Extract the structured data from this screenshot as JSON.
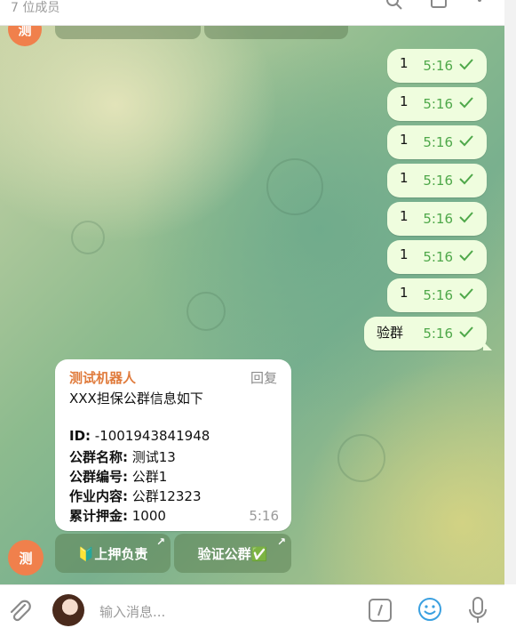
{
  "header": {
    "subtitle": "7 位成员"
  },
  "top_avatar_letter": "测",
  "outgoing": [
    {
      "text": "1",
      "time": "5:16"
    },
    {
      "text": "1",
      "time": "5:16"
    },
    {
      "text": "1",
      "time": "5:16"
    },
    {
      "text": "1",
      "time": "5:16"
    },
    {
      "text": "1",
      "time": "5:16"
    },
    {
      "text": "1",
      "time": "5:16"
    },
    {
      "text": "1",
      "time": "5:16"
    },
    {
      "text": "验群",
      "time": "5:16"
    }
  ],
  "incoming": {
    "sender": "测试机器人",
    "reply_label": "回复",
    "intro": "XXX担保公群信息如下",
    "id_label": "ID:",
    "id_value": " -1001943841948",
    "name_label": "公群名称:",
    "name_value": " 测试13",
    "num_label": "公群编号:",
    "num_value": " 公群1",
    "work_label": "作业内容:",
    "work_value": " 公群12323",
    "deposit_label": "累计押金:",
    "deposit_value": " 1000",
    "time": "5:16"
  },
  "bot_avatar_letter": "测",
  "keyboard": [
    {
      "label": "🔰上押负责",
      "arrow": "↗"
    },
    {
      "label": "验证公群✅",
      "arrow": "↗"
    }
  ],
  "composer": {
    "placeholder": "输入消息..."
  },
  "colors": {
    "accent": "#4fa84a",
    "sender": "#e07b3c",
    "avatar": "#f0804c",
    "outgoing_bg": "#effdde"
  }
}
